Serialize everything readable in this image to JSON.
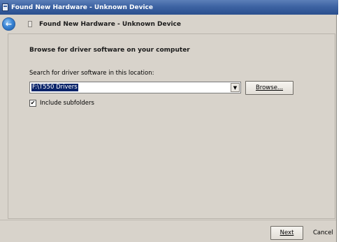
{
  "window": {
    "title": "Found New Hardware - Unknown Device",
    "icon": "hardware-wizard-icon"
  },
  "navbar": {
    "back_icon": "back-arrow-icon",
    "title": "Found New Hardware - Unknown Device"
  },
  "content": {
    "heading": "Browse for driver software on your computer",
    "search_label": "Search for driver software in this location:",
    "location_value": "F:\\T550 Drivers",
    "dropdown_arrow": "▼",
    "browse_label": "Browse...",
    "include_subfolders_label": "Include subfolders",
    "include_subfolders_checked": true,
    "check_mark": "✔"
  },
  "footer": {
    "next_label": "Next",
    "cancel_label": "Cancel"
  }
}
